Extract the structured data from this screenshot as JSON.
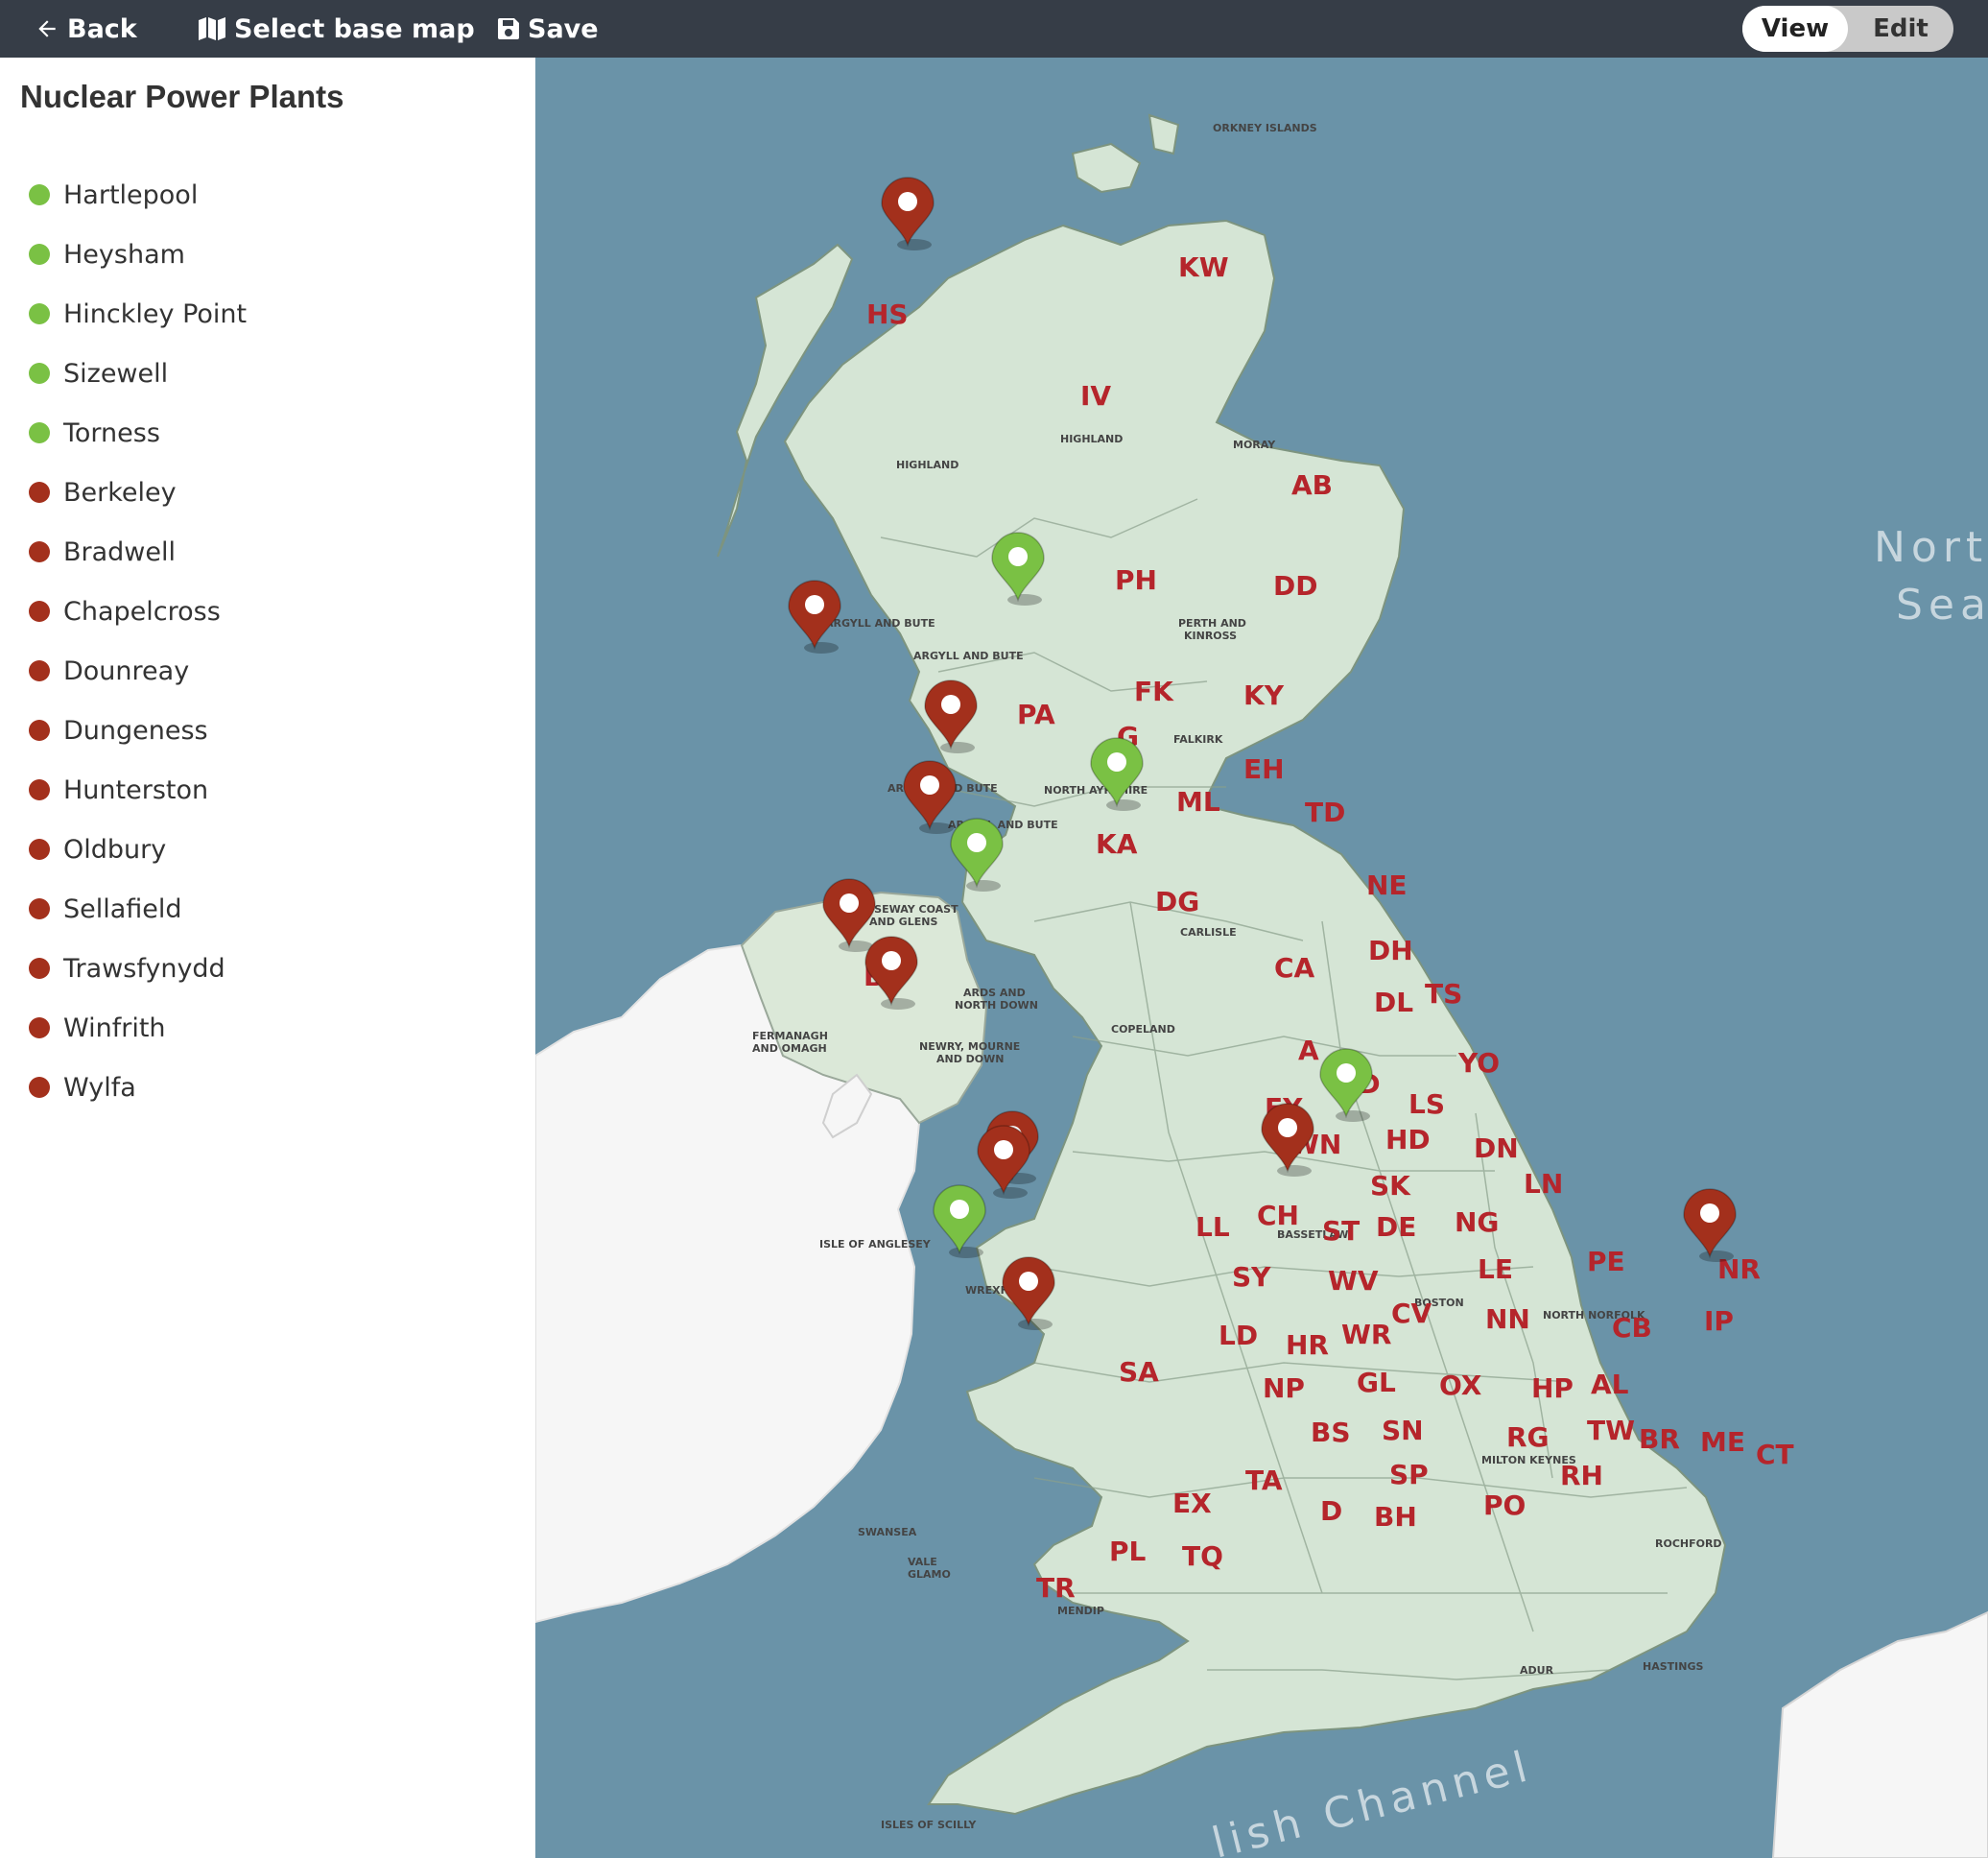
{
  "toolbar": {
    "back_label": "Back",
    "select_base_map_label": "Select base map",
    "save_label": "Save",
    "view_label": "View",
    "edit_label": "Edit"
  },
  "sidebar": {
    "title": "Nuclear Power Plants",
    "items": [
      {
        "label": "Hartlepool",
        "color": "#7ac144"
      },
      {
        "label": "Heysham",
        "color": "#7ac144"
      },
      {
        "label": "Hinckley Point",
        "color": "#7ac144"
      },
      {
        "label": "Sizewell",
        "color": "#7ac144"
      },
      {
        "label": "Torness",
        "color": "#7ac144"
      },
      {
        "label": "Berkeley",
        "color": "#a3301c"
      },
      {
        "label": "Bradwell",
        "color": "#a3301c"
      },
      {
        "label": "Chapelcross",
        "color": "#a3301c"
      },
      {
        "label": "Dounreay",
        "color": "#a3301c"
      },
      {
        "label": "Dungeness",
        "color": "#a3301c"
      },
      {
        "label": "Hunterston",
        "color": "#a3301c"
      },
      {
        "label": "Oldbury",
        "color": "#a3301c"
      },
      {
        "label": "Sellafield",
        "color": "#a3301c"
      },
      {
        "label": "Trawsfynydd",
        "color": "#a3301c"
      },
      {
        "label": "Winfrith",
        "color": "#a3301c"
      },
      {
        "label": "Wylfa",
        "color": "#a3301c"
      }
    ]
  },
  "map": {
    "colors": {
      "sea": "#6a93a8",
      "land": "#d6e6d6",
      "ireland": "#f6f6f6",
      "active": "#7ac144",
      "closed": "#a3301c"
    },
    "sea_labels": [
      "Nort",
      "Sea",
      "lish Channel"
    ],
    "area_labels": [
      "ORKNEY ISLANDS",
      "HIGHLAND",
      "HIGHLAND",
      "MORAY",
      "ARGYLL AND BUTE",
      "ARGYLL AND BUTE",
      "PERTH AND",
      "KINROSS",
      "FALKIRK",
      "ARGYLL AND BUTE",
      "NORTH AYRSHIRE",
      "ARGYLL AND BUTE",
      "CAUSEWAY COAST",
      "AND GLENS",
      "ARDS AND",
      "NORTH DOWN",
      "FERMANAGH",
      "AND OMAGH",
      "NEWRY, MOURNE",
      "AND DOWN",
      "CARLISLE",
      "COPELAND",
      "ISLE OF ANGLESEY",
      "WREXHAM",
      "BASSETLAW",
      "BOSTON",
      "NORTH NORFOLK",
      "MILTON KEYNES",
      "ROCHFORD",
      "SWANSEA",
      "VALE",
      "GLAMO",
      "MENDIP",
      "HASTINGS",
      "ADUR",
      "ISLES OF SCILLY"
    ],
    "postcode_labels": [
      "KW",
      "HS",
      "IV",
      "AB",
      "DD",
      "PH",
      "FK",
      "KY",
      "PA",
      "G",
      "EH",
      "ML",
      "TD",
      "KA",
      "DG",
      "NE",
      "BT",
      "CA",
      "DH",
      "TS",
      "DL",
      "YO",
      "A",
      "BD",
      "LS",
      "FY",
      "WN",
      "HD",
      "DN",
      "SK",
      "LN",
      "CH",
      "LL",
      "ST",
      "DE",
      "NG",
      "PE",
      "NR",
      "SY",
      "WV",
      "LE",
      "IP",
      "CV",
      "NN",
      "CB",
      "LD",
      "HR",
      "WR",
      "SA",
      "NP",
      "GL",
      "OX",
      "HP",
      "AL",
      "SN",
      "RG",
      "TW",
      "BR",
      "ME",
      "CT",
      "BS",
      "TA",
      "SP",
      "RH",
      "EX",
      "D",
      "BH",
      "PO",
      "PL",
      "TQ",
      "TR"
    ],
    "markers": [
      {
        "status": "closed",
        "site": "Dounreay"
      },
      {
        "status": "active",
        "site": "Torness"
      },
      {
        "status": "closed",
        "site": "Hunterston"
      },
      {
        "status": "closed",
        "site": "Chapelcross"
      },
      {
        "status": "active",
        "site": "Hartlepool"
      },
      {
        "status": "closed",
        "site": "Sellafield"
      },
      {
        "status": "active",
        "site": "Heysham"
      },
      {
        "status": "closed",
        "site": "Wylfa"
      },
      {
        "status": "closed",
        "site": "Trawsfynydd"
      },
      {
        "status": "active",
        "site": "Sizewell"
      },
      {
        "status": "closed",
        "site": "Bradwell"
      },
      {
        "status": "closed",
        "site": "Oldbury"
      },
      {
        "status": "closed",
        "site": "Berkeley"
      },
      {
        "status": "active",
        "site": "Hinckley Point"
      },
      {
        "status": "closed",
        "site": "Dungeness"
      },
      {
        "status": "closed",
        "site": "Winfrith"
      }
    ]
  }
}
